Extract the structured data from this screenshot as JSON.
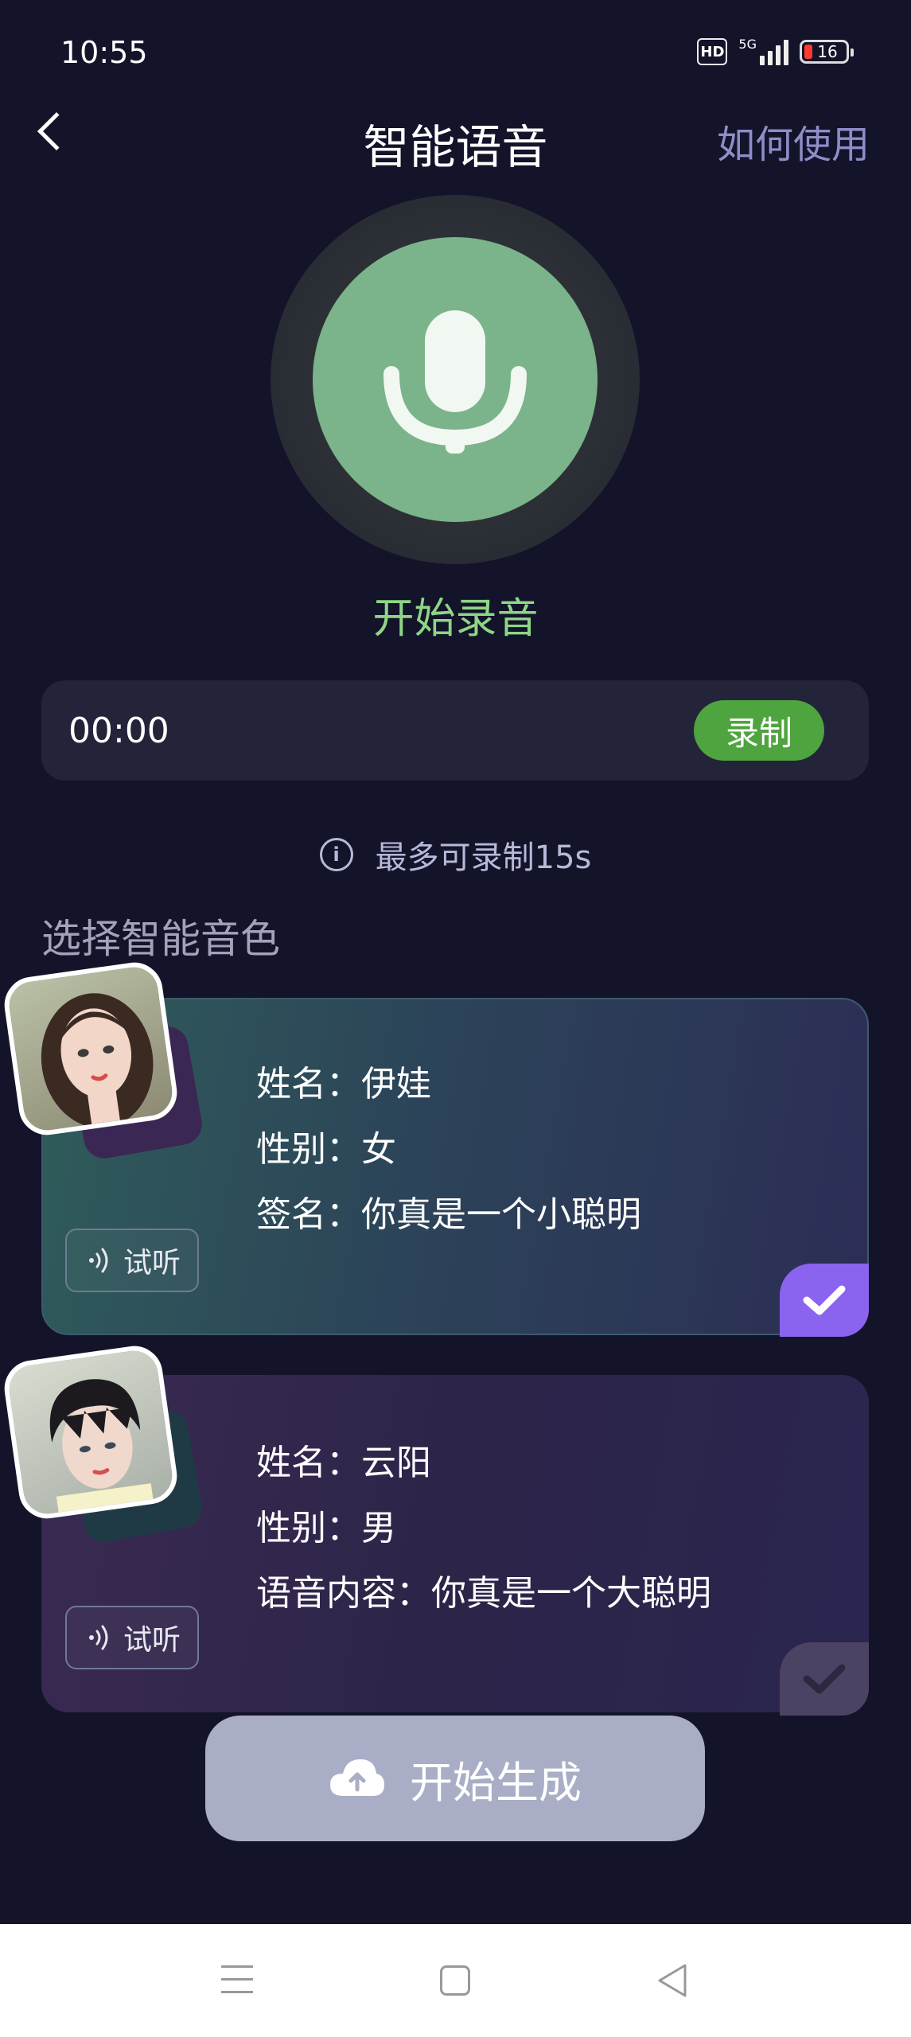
{
  "status_bar": {
    "time": "10:55",
    "hd": "HD",
    "network": "5G",
    "battery": "16"
  },
  "header": {
    "title": "智能语音",
    "help_link": "如何使用"
  },
  "recorder": {
    "start_label": "开始录音",
    "time": "00:00",
    "record_button": "录制",
    "note": "最多可录制15s"
  },
  "voice_section": {
    "label": "选择智能音色",
    "cards": [
      {
        "name_line": "姓名：伊娃",
        "gender_line": "性别：女",
        "extra_line": "签名：你真是一个小聪明",
        "listen_label": "试听",
        "selected": true
      },
      {
        "name_line": "姓名：云阳",
        "gender_line": "性别：男",
        "extra_line": "语音内容：你真是一个大聪明",
        "listen_label": "试听",
        "selected": false
      }
    ]
  },
  "generate_button": "开始生成",
  "colors": {
    "background": "#13132a",
    "accent_green": "#4ea43e",
    "accent_purple": "#8a63ee"
  }
}
